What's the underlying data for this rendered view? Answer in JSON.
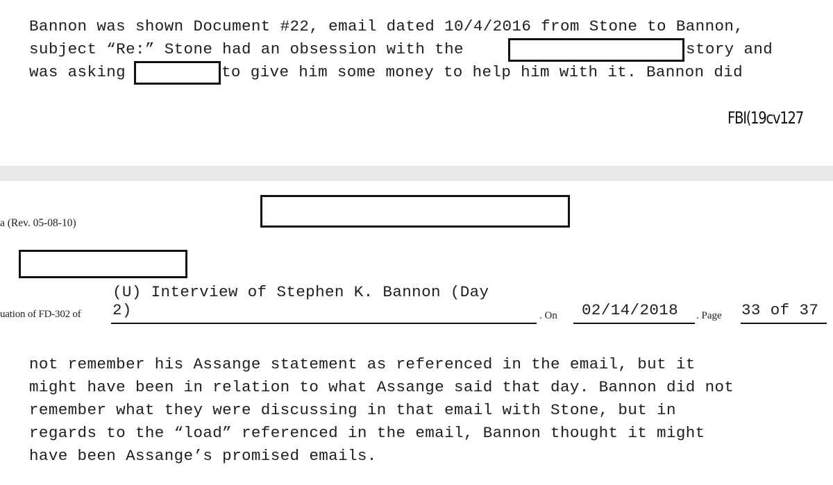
{
  "page_top": {
    "paragraph_lines": [
      "Bannon was shown Document #22, email dated 10/4/2016 from Stone to Bannon,",
      "subject “Re:” Stone had an obsession with the",
      "story and",
      "was asking",
      "to give him some money to help him with it. Bannon did"
    ],
    "bates_stamp": "FBI(19cv127"
  },
  "page_bottom": {
    "form_revision": "a (Rev. 05-08-10)",
    "header": {
      "prefix_label": "uation of FD-302 of",
      "title_line1": "(U) Interview of Stephen K. Bannon (Day",
      "title_line2": "2)",
      "on_label": ". On",
      "date": "02/14/2018",
      "page_label": ". Page",
      "page_value": "33 of 37"
    },
    "paragraph_lines": [
      "not remember his Assange statement as referenced in the email, but it",
      "might have been in relation to what Assange said that day. Bannon did not",
      "remember what they were discussing in that email with Stone, but in",
      "regards to the “load” referenced in the email, Bannon thought it might",
      "have been Assange’s promised emails."
    ]
  }
}
